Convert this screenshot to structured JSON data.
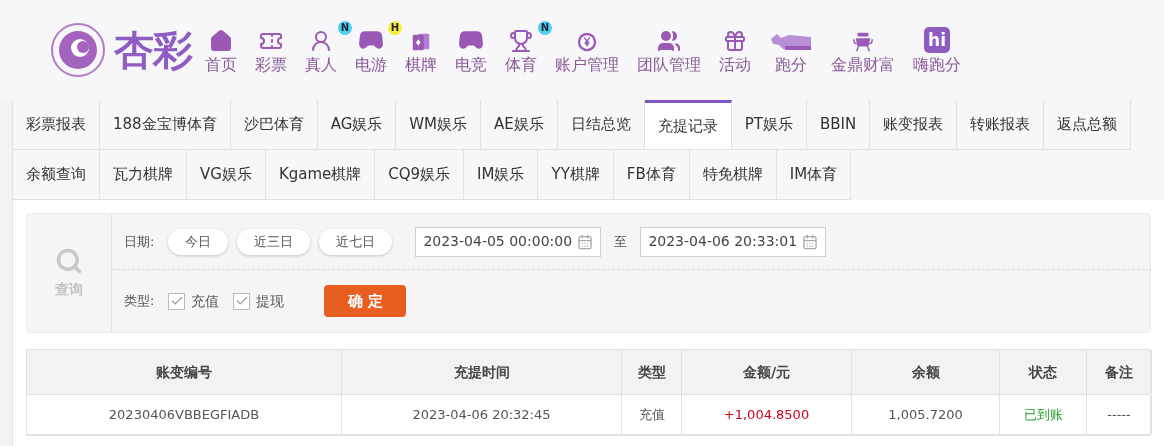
{
  "logo": {
    "text": "杏彩"
  },
  "nav": [
    {
      "label": "首页"
    },
    {
      "label": "彩票"
    },
    {
      "label": "真人",
      "badge": {
        "text": "N",
        "color": "#4fd0f0"
      }
    },
    {
      "label": "电游",
      "badge": {
        "text": "H",
        "color": "#f5ef3c"
      }
    },
    {
      "label": "棋牌"
    },
    {
      "label": "电竞"
    },
    {
      "label": "体育",
      "badge": {
        "text": "N",
        "color": "#4fd0f0"
      }
    },
    {
      "label": "账户管理"
    },
    {
      "label": "团队管理"
    },
    {
      "label": "活动"
    },
    {
      "label": "跑分"
    },
    {
      "label": "金鼎财富"
    },
    {
      "label": "嗨跑分",
      "icon_text": "hi"
    }
  ],
  "tab_rows": [
    [
      {
        "label": "彩票报表",
        "selected": false
      },
      {
        "label": "188金宝博体育",
        "selected": false
      },
      {
        "label": "沙巴体育",
        "selected": false
      },
      {
        "label": "AG娱乐",
        "selected": false
      },
      {
        "label": "WM娱乐",
        "selected": false
      },
      {
        "label": "AE娱乐",
        "selected": false
      },
      {
        "label": "日结总览",
        "selected": false
      },
      {
        "label": "充提记录",
        "selected": true
      },
      {
        "label": "PT娱乐",
        "selected": false
      },
      {
        "label": "BBIN",
        "selected": false
      },
      {
        "label": "账变报表",
        "selected": false
      },
      {
        "label": "转账报表",
        "selected": false
      },
      {
        "label": "返点总额",
        "selected": false
      }
    ],
    [
      {
        "label": "余额查询",
        "selected": false
      },
      {
        "label": "瓦力棋牌",
        "selected": false
      },
      {
        "label": "VG娱乐",
        "selected": false
      },
      {
        "label": "Kgame棋牌",
        "selected": false
      },
      {
        "label": "CQ9娱乐",
        "selected": false
      },
      {
        "label": "IM娱乐",
        "selected": false
      },
      {
        "label": "YY棋牌",
        "selected": false
      },
      {
        "label": "FB体育",
        "selected": false
      },
      {
        "label": "特免棋牌",
        "selected": false
      },
      {
        "label": "IM体育",
        "selected": false
      }
    ]
  ],
  "search": {
    "title": "查询",
    "date_label": "日期:",
    "quick_ranges": [
      "今日",
      "近三日",
      "近七日"
    ],
    "start": "2023-04-05 00:00:00",
    "separator": "至",
    "end": "2023-04-06 20:33:01",
    "type_label": "类型:",
    "types": [
      {
        "label": "充值",
        "checked": true
      },
      {
        "label": "提现",
        "checked": true
      }
    ],
    "submit": "确 定"
  },
  "table": {
    "columns": [
      "账变编号",
      "充提时间",
      "类型",
      "金额/元",
      "余额",
      "状态",
      "备注"
    ],
    "rows": [
      [
        "20230406VBBEGFIADB",
        "2023-04-06 20:32:45",
        "充值",
        "+1,004.8500",
        "1,005.7200",
        "已到账",
        "-----"
      ]
    ]
  }
}
